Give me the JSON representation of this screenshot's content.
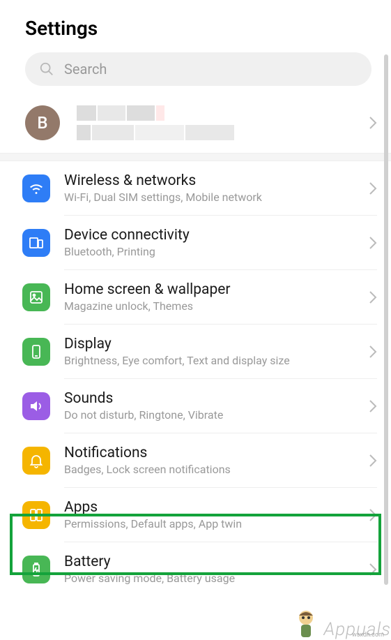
{
  "header": {
    "title": "Settings"
  },
  "search": {
    "placeholder": "Search"
  },
  "account": {
    "avatar_initial": "B"
  },
  "items": [
    {
      "title": "Wireless & networks",
      "subtitle": "Wi-Fi, Dual SIM settings, Mobile network",
      "icon": "wifi",
      "color": "#2e7df6"
    },
    {
      "title": "Device connectivity",
      "subtitle": "Bluetooth, Printing",
      "icon": "devices",
      "color": "#2e7df6"
    },
    {
      "title": "Home screen & wallpaper",
      "subtitle": "Magazine unlock, Themes",
      "icon": "image",
      "color": "#48b755"
    },
    {
      "title": "Display",
      "subtitle": "Brightness, Eye comfort, Text and display size",
      "icon": "phone",
      "color": "#48b755"
    },
    {
      "title": "Sounds",
      "subtitle": "Do not disturb, Ringtone, Vibrate",
      "icon": "speaker",
      "color": "#9b5de5"
    },
    {
      "title": "Notifications",
      "subtitle": "Badges, Lock screen notifications",
      "icon": "bell",
      "color": "#f5b500"
    },
    {
      "title": "Apps",
      "subtitle": "Permissions, Default apps, App twin",
      "icon": "apps",
      "color": "#f5b500"
    },
    {
      "title": "Battery",
      "subtitle": "Power saving mode, Battery usage",
      "icon": "battery",
      "color": "#48b755"
    }
  ],
  "watermark": "Appuals",
  "source": "wsxdn.com"
}
